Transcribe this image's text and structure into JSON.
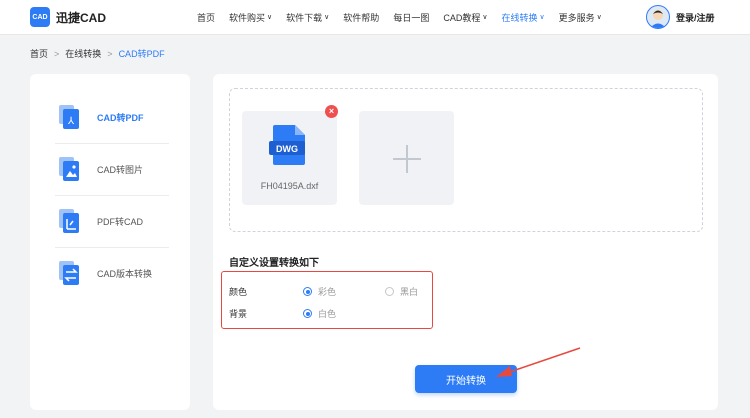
{
  "brand": {
    "badge": "CAD",
    "name": "迅捷CAD"
  },
  "nav": [
    {
      "label": "首页",
      "dropdown": false,
      "active": false
    },
    {
      "label": "软件购买",
      "dropdown": true,
      "active": false
    },
    {
      "label": "软件下载",
      "dropdown": true,
      "active": false
    },
    {
      "label": "软件帮助",
      "dropdown": false,
      "active": false
    },
    {
      "label": "每日一图",
      "dropdown": false,
      "active": false
    },
    {
      "label": "CAD教程",
      "dropdown": true,
      "active": false
    },
    {
      "label": "在线转换",
      "dropdown": true,
      "active": true
    },
    {
      "label": "更多服务",
      "dropdown": true,
      "active": false
    }
  ],
  "chevron": "∨",
  "login": "登录/注册",
  "breadcrumb": [
    "首页",
    "在线转换",
    "CAD转PDF"
  ],
  "breadcrumb_sep": ">",
  "sidebar": [
    {
      "label": "CAD转PDF",
      "icon": "cad-to-pdf-icon",
      "active": true
    },
    {
      "label": "CAD转图片",
      "icon": "cad-to-image-icon",
      "active": false
    },
    {
      "label": "PDF转CAD",
      "icon": "pdf-to-cad-icon",
      "active": false
    },
    {
      "label": "CAD版本转换",
      "icon": "cad-version-icon",
      "active": false
    }
  ],
  "upload": {
    "file_name": "FH04195A.dxf",
    "file_type": "DWG",
    "remove_symbol": "×",
    "add_symbol": "+"
  },
  "settings": {
    "title": "自定义设置转换如下",
    "color_label": "颜色",
    "color_options": [
      {
        "label": "彩色",
        "selected": true
      },
      {
        "label": "黑白",
        "selected": false
      }
    ],
    "bg_label": "背景",
    "bg_options": [
      {
        "label": "白色",
        "selected": true
      }
    ]
  },
  "start_button": "开始转换",
  "colors": {
    "accent": "#2d7cf6",
    "highlight": "#e8493f"
  }
}
